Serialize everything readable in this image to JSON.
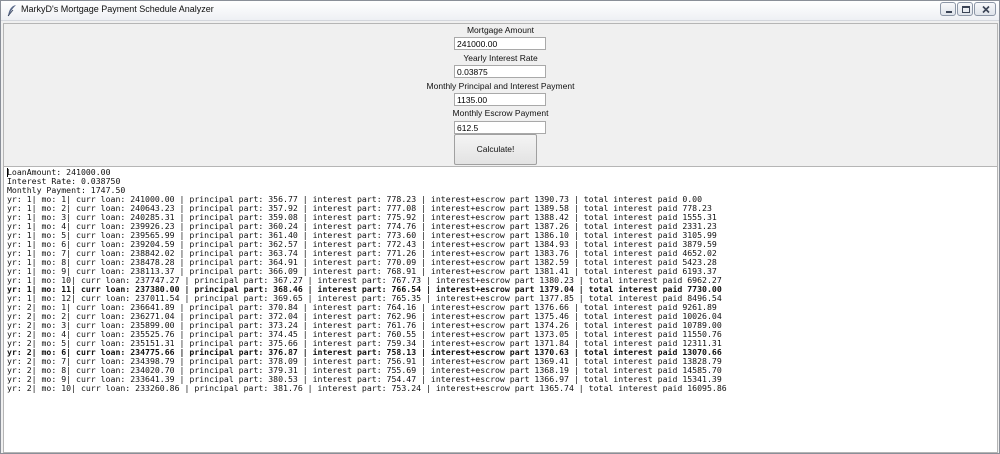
{
  "window": {
    "title": "MarkyD's Mortgage Payment Schedule Analyzer",
    "icon": "feather-icon",
    "controls": [
      "minimize-icon",
      "maximize-icon",
      "close-icon"
    ]
  },
  "form": {
    "mortgage_amount_label": "Mortgage Amount",
    "mortgage_amount_value": "241000.00",
    "interest_rate_label": "Yearly Interest Rate",
    "interest_rate_value": "0.03875",
    "monthly_pi_label": "Monthly Principal and Interest Payment",
    "monthly_pi_value": "1135.00",
    "monthly_escrow_label": "Monthly Escrow Payment",
    "monthly_escrow_value": "612.5",
    "calculate_label": "Calculate!"
  },
  "output": {
    "summary": [
      "LoanAmount: 241000.00",
      "Interest Rate: 0.038750",
      "Monthly Payment: 1747.50"
    ],
    "schedule": [
      "yr: 1| mo: 1| curr loan: 241000.00 | principal part: 356.77 | interest part: 778.23 | interest+escrow part 1390.73 | total interest paid 0.00",
      "yr: 1| mo: 2| curr loan: 240643.23 | principal part: 357.92 | interest part: 777.08 | interest+escrow part 1389.58 | total interest paid 778.23",
      "yr: 1| mo: 3| curr loan: 240285.31 | principal part: 359.08 | interest part: 775.92 | interest+escrow part 1388.42 | total interest paid 1555.31",
      "yr: 1| mo: 4| curr loan: 239926.23 | principal part: 360.24 | interest part: 774.76 | interest+escrow part 1387.26 | total interest paid 2331.23",
      "yr: 1| mo: 5| curr loan: 239565.99 | principal part: 361.40 | interest part: 773.60 | interest+escrow part 1386.10 | total interest paid 3105.99",
      "yr: 1| mo: 6| curr loan: 239204.59 | principal part: 362.57 | interest part: 772.43 | interest+escrow part 1384.93 | total interest paid 3879.59",
      "yr: 1| mo: 7| curr loan: 238842.02 | principal part: 363.74 | interest part: 771.26 | interest+escrow part 1383.76 | total interest paid 4652.02",
      "yr: 1| mo: 8| curr loan: 238478.28 | principal part: 364.91 | interest part: 770.09 | interest+escrow part 1382.59 | total interest paid 5423.28",
      "yr: 1| mo: 9| curr loan: 238113.37 | principal part: 366.09 | interest part: 768.91 | interest+escrow part 1381.41 | total interest paid 6193.37",
      "yr: 1| mo: 10| curr loan: 237747.27 | principal part: 367.27 | interest part: 767.73 | interest+escrow part 1380.23 | total interest paid 6962.27",
      "yr: 1| mo: 11| curr loan: 237380.00 | principal part: 368.46 | interest part: 766.54 | interest+escrow part 1379.04 | total interest paid 7730.00",
      "yr: 1| mo: 12| curr loan: 237011.54 | principal part: 369.65 | interest part: 765.35 | interest+escrow part 1377.85 | total interest paid 8496.54",
      "yr: 2| mo: 1| curr loan: 236641.89 | principal part: 370.84 | interest part: 764.16 | interest+escrow part 1376.66 | total interest paid 9261.89",
      "yr: 2| mo: 2| curr loan: 236271.04 | principal part: 372.04 | interest part: 762.96 | interest+escrow part 1375.46 | total interest paid 10026.04",
      "yr: 2| mo: 3| curr loan: 235899.00 | principal part: 373.24 | interest part: 761.76 | interest+escrow part 1374.26 | total interest paid 10789.00",
      "yr: 2| mo: 4| curr loan: 235525.76 | principal part: 374.45 | interest part: 760.55 | interest+escrow part 1373.05 | total interest paid 11550.76",
      "yr: 2| mo: 5| curr loan: 235151.31 | principal part: 375.66 | interest part: 759.34 | interest+escrow part 1371.84 | total interest paid 12311.31",
      "yr: 2| mo: 6| curr loan: 234775.66 | principal part: 376.87 | interest part: 758.13 | interest+escrow part 1370.63 | total interest paid 13070.66",
      "yr: 2| mo: 7| curr loan: 234398.79 | principal part: 378.09 | interest part: 756.91 | interest+escrow part 1369.41 | total interest paid 13828.79",
      "yr: 2| mo: 8| curr loan: 234020.70 | principal part: 379.31 | interest part: 755.69 | interest+escrow part 1368.19 | total interest paid 14585.70",
      "yr: 2| mo: 9| curr loan: 233641.39 | principal part: 380.53 | interest part: 754.47 | interest+escrow part 1366.97 | total interest paid 15341.39",
      "yr: 2| mo: 10| curr loan: 233260.86 | principal part: 381.76 | interest part: 753.24 | interest+escrow part 1365.74 | total interest paid 16095.86"
    ]
  }
}
